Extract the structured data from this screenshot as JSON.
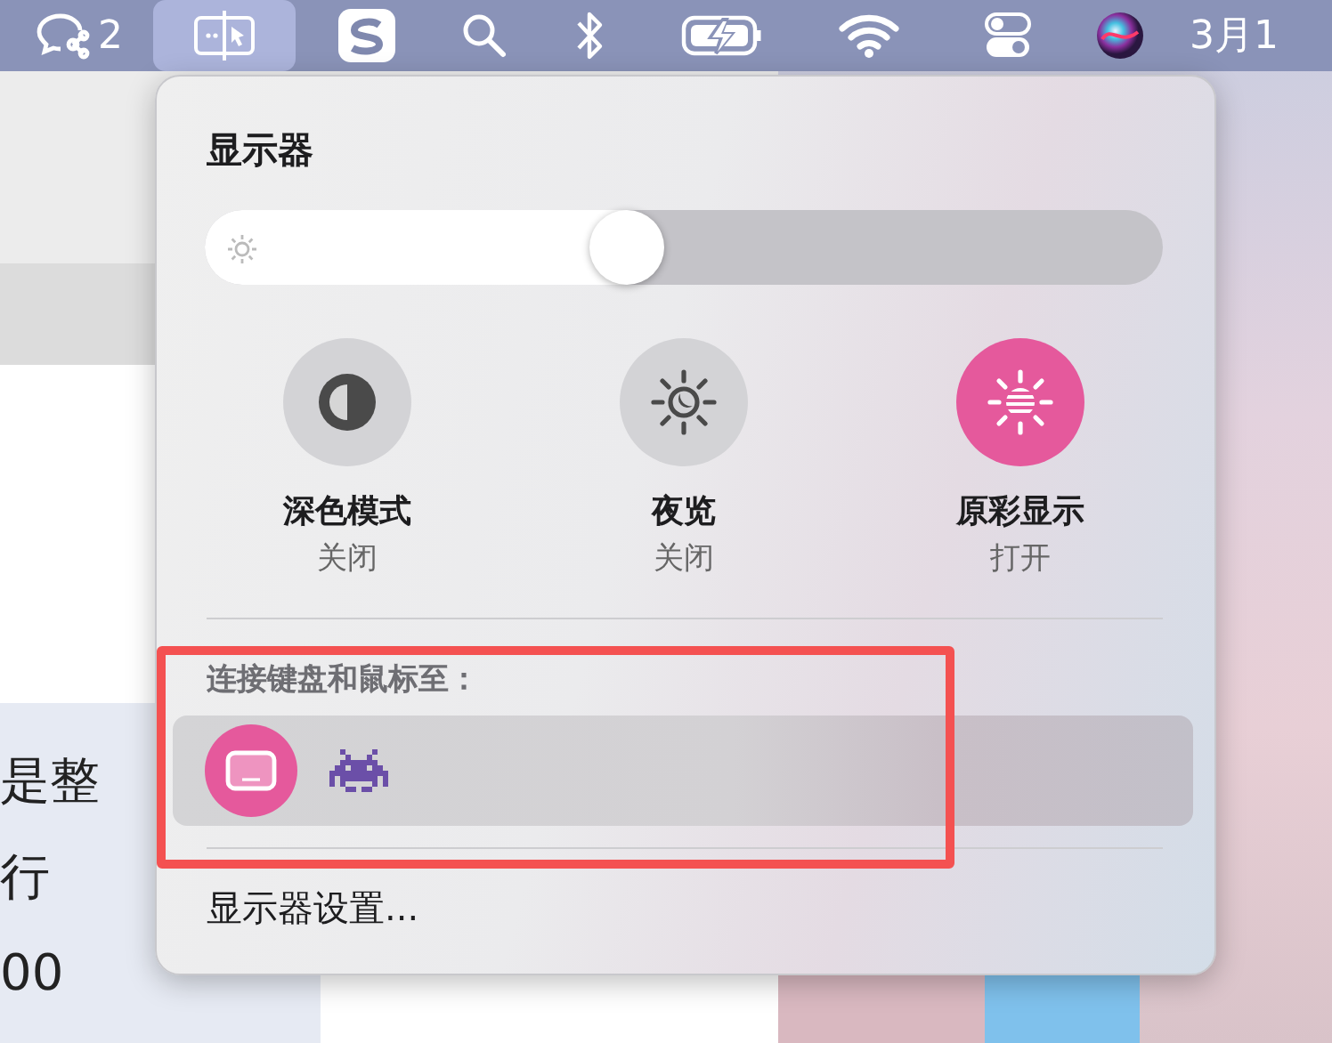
{
  "menu_bar": {
    "items": [
      {
        "kind": "chat",
        "badge": "2",
        "selected": false
      },
      {
        "kind": "display",
        "selected": true
      },
      {
        "kind": "s-app",
        "selected": false
      },
      {
        "kind": "search",
        "selected": false
      },
      {
        "kind": "bluetooth",
        "selected": false
      },
      {
        "kind": "battery",
        "selected": false
      },
      {
        "kind": "wifi",
        "selected": false
      },
      {
        "kind": "control-center",
        "selected": false
      },
      {
        "kind": "siri",
        "selected": false
      }
    ],
    "clock": "3月1"
  },
  "background_window": {
    "texts": [
      "是整",
      "行",
      "00"
    ]
  },
  "display_panel": {
    "title": "显示器",
    "brightness": {
      "level": 0.44
    },
    "toggles": [
      {
        "kind": "dark-mode",
        "label": "深色模式",
        "status": "关闭",
        "on": false
      },
      {
        "kind": "night-shift",
        "label": "夜览",
        "status": "关闭",
        "on": false
      },
      {
        "kind": "true-tone",
        "label": "原彩显示",
        "status": "打开",
        "on": true
      }
    ],
    "keyboard_section": {
      "heading": "连接键盘和鼠标至：",
      "highlighted": true,
      "devices": [
        {
          "kind": "laptop",
          "selected": true
        },
        {
          "kind": "invader",
          "selected": false
        }
      ]
    },
    "settings_link": "显示器设置..."
  }
}
